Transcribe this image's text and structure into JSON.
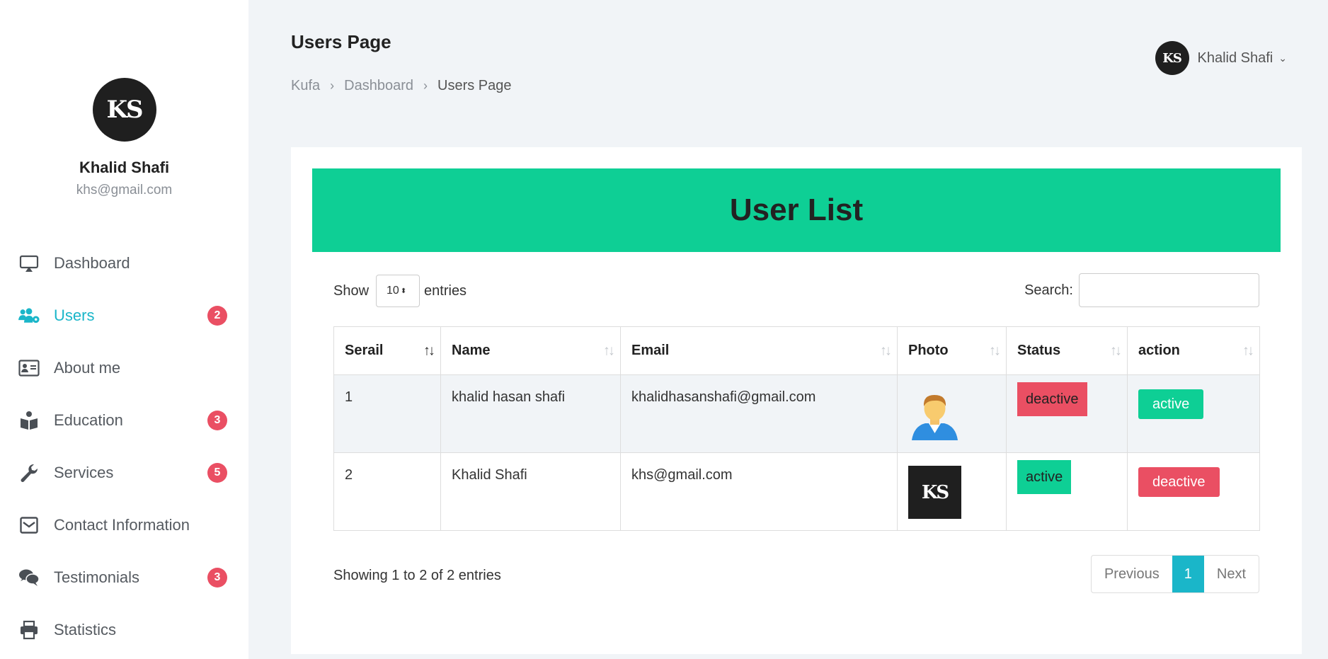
{
  "sidebar": {
    "avatar_text": "KS",
    "name": "Khalid Shafi",
    "email": "khs@gmail.com",
    "items": [
      {
        "label": "Dashboard",
        "icon": "monitor-icon",
        "badge": ""
      },
      {
        "label": "Users",
        "icon": "users-gear-icon",
        "badge": "2"
      },
      {
        "label": "About me",
        "icon": "id-card-icon",
        "badge": ""
      },
      {
        "label": "Education",
        "icon": "book-reader-icon",
        "badge": "3"
      },
      {
        "label": "Services",
        "icon": "wrench-icon",
        "badge": "5"
      },
      {
        "label": "Contact Information",
        "icon": "envelope-icon",
        "badge": ""
      },
      {
        "label": "Testimonials",
        "icon": "comments-icon",
        "badge": "3"
      },
      {
        "label": "Statistics",
        "icon": "printer-icon",
        "badge": ""
      }
    ]
  },
  "header": {
    "title": "Users Page",
    "breadcrumb": [
      "Kufa",
      "Dashboard",
      "Users Page"
    ],
    "user_name": "Khalid Shafi",
    "avatar_text": "KS"
  },
  "card": {
    "title": "User List",
    "show_label": "Show",
    "entries_label": "entries",
    "page_size": "10",
    "search_label": "Search:",
    "search_placeholder": ""
  },
  "table": {
    "columns": [
      "Serail",
      "Name",
      "Email",
      "Photo",
      "Status",
      "action"
    ],
    "rows": [
      {
        "serial": "1",
        "name": "khalid hasan shafi",
        "email": "khalidhasanshafi@gmail.com",
        "photo": "user-avatar-icon",
        "status": "deactive",
        "action": "active"
      },
      {
        "serial": "2",
        "name": "Khalid Shafi",
        "email": "khs@gmail.com",
        "photo": "KS",
        "status": "active",
        "action": "deactive"
      }
    ]
  },
  "footer": {
    "info": "Showing 1 to 2 of 2 entries",
    "previous": "Previous",
    "current_page": "1",
    "next": "Next"
  },
  "colors": {
    "accent": "#1ab6c9",
    "header_green": "#0ecf95",
    "danger": "#ea4f63"
  }
}
